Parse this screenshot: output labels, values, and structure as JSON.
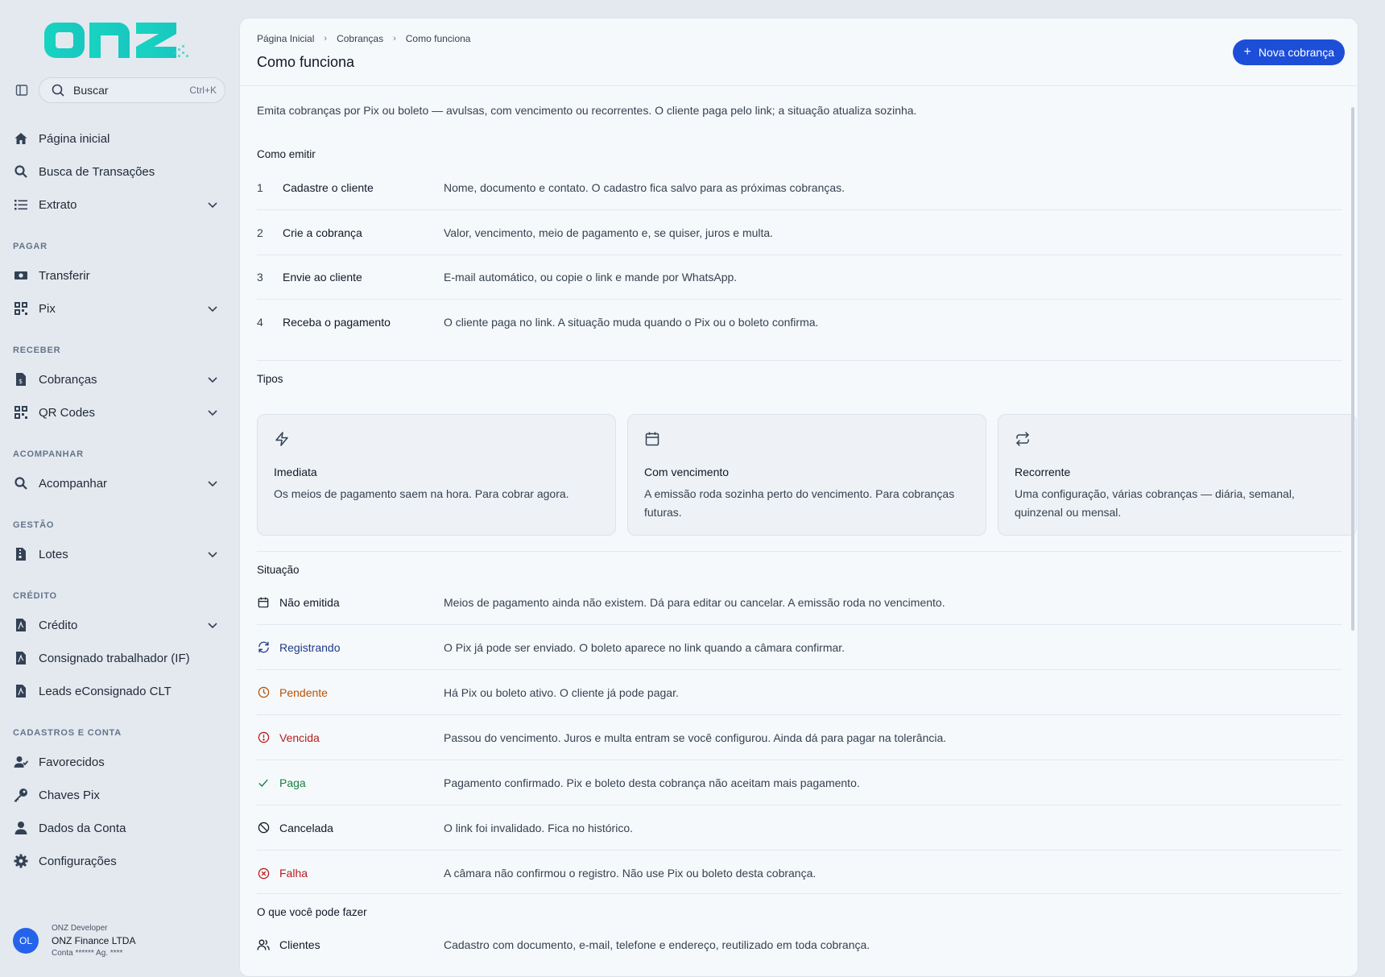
{
  "brand": {
    "logo_text": "onz"
  },
  "search": {
    "placeholder": "Buscar",
    "shortcut": "Ctrl+K"
  },
  "sidebar": {
    "items_top": [
      {
        "label": "Página inicial",
        "icon": "home-icon"
      },
      {
        "label": "Busca de Transações",
        "icon": "search-icon"
      },
      {
        "label": "Extrato",
        "icon": "list-icon",
        "expandable": true
      }
    ],
    "sections": [
      {
        "title": "PAGAR",
        "items": [
          {
            "label": "Transferir",
            "icon": "money-icon"
          },
          {
            "label": "Pix",
            "icon": "qr-icon",
            "expandable": true
          }
        ]
      },
      {
        "title": "RECEBER",
        "items": [
          {
            "label": "Cobranças",
            "icon": "invoice-icon",
            "expandable": true
          },
          {
            "label": "QR Codes",
            "icon": "qr-icon",
            "expandable": true
          }
        ]
      },
      {
        "title": "ACOMPANHAR",
        "items": [
          {
            "label": "Acompanhar",
            "icon": "search-icon",
            "expandable": true
          }
        ]
      },
      {
        "title": "GESTÃO",
        "items": [
          {
            "label": "Lotes",
            "icon": "zip-file-icon",
            "expandable": true
          }
        ]
      },
      {
        "title": "CRÉDITO",
        "items": [
          {
            "label": "Crédito",
            "icon": "pdf-file-icon",
            "expandable": true
          },
          {
            "label": "Consignado trabalhador (IF)",
            "icon": "pdf-file-icon"
          },
          {
            "label": "Leads eConsignado CLT",
            "icon": "pdf-file-icon"
          }
        ]
      },
      {
        "title": "CADASTROS E CONTA",
        "items": [
          {
            "label": "Favorecidos",
            "icon": "user-check-icon"
          },
          {
            "label": "Chaves Pix",
            "icon": "key-icon"
          },
          {
            "label": "Dados da Conta",
            "icon": "user-icon"
          },
          {
            "label": "Configurações",
            "icon": "gear-icon"
          }
        ]
      }
    ]
  },
  "user": {
    "initials": "OL",
    "role": "ONZ Developer",
    "company": "ONZ Finance LTDA",
    "account": "Conta ****** Ag. ****"
  },
  "header": {
    "breadcrumb": [
      "Página Inicial",
      "Cobranças",
      "Como funciona"
    ],
    "title": "Como funciona",
    "primary_button": "Nova cobrança"
  },
  "intro": "Emita cobranças por Pix ou boleto — avulsas, com vencimento ou recorrentes. O cliente paga pelo link; a situação atualiza sozinha.",
  "how_to": {
    "title": "Como emitir",
    "steps": [
      {
        "num": "1",
        "label": "Cadastre o cliente",
        "desc": "Nome, documento e contato. O cadastro fica salvo para as próximas cobranças."
      },
      {
        "num": "2",
        "label": "Crie a cobrança",
        "desc": "Valor, vencimento, meio de pagamento e, se quiser, juros e multa."
      },
      {
        "num": "3",
        "label": "Envie ao cliente",
        "desc": "E-mail automático, ou copie o link e mande por WhatsApp."
      },
      {
        "num": "4",
        "label": "Receba o pagamento",
        "desc": "O cliente paga no link. A situação muda quando o Pix ou o boleto confirma."
      }
    ]
  },
  "types": {
    "title": "Tipos",
    "cards": [
      {
        "icon": "lightning-icon",
        "title": "Imediata",
        "desc": "Os meios de pagamento saem na hora. Para cobrar agora."
      },
      {
        "icon": "calendar-icon",
        "title": "Com vencimento",
        "desc": "A emissão roda sozinha perto do vencimento. Para cobranças futuras."
      },
      {
        "icon": "repeat-icon",
        "title": "Recorrente",
        "desc": "Uma configuração, várias cobranças — diária, semanal, quinzenal ou mensal."
      }
    ]
  },
  "status": {
    "title": "Situação",
    "rows": [
      {
        "icon": "calendar-icon",
        "label": "Não emitida",
        "color": "#111827",
        "desc": "Meios de pagamento ainda não existem. Dá para editar ou cancelar. A emissão roda no vencimento."
      },
      {
        "icon": "refresh-icon",
        "label": "Registrando",
        "color": "#1e3a8a",
        "desc": "O Pix já pode ser enviado. O boleto aparece no link quando a câmara confirmar."
      },
      {
        "icon": "clock-icon",
        "label": "Pendente",
        "color": "#b45309",
        "desc": "Há Pix ou boleto ativo. O cliente já pode pagar."
      },
      {
        "icon": "alert-circle-icon",
        "label": "Vencida",
        "color": "#b91c1c",
        "desc": "Passou do vencimento. Juros e multa entram se você configurou. Ainda dá para pagar na tolerância."
      },
      {
        "icon": "check-icon",
        "label": "Paga",
        "color": "#15803d",
        "desc": "Pagamento confirmado. Pix e boleto desta cobrança não aceitam mais pagamento."
      },
      {
        "icon": "ban-icon",
        "label": "Cancelada",
        "color": "#111827",
        "desc": "O link foi invalidado. Fica no histórico."
      },
      {
        "icon": "x-circle-icon",
        "label": "Falha",
        "color": "#b91c1c",
        "desc": "A câmara não confirmou o registro. Não use Pix ou boleto desta cobrança."
      }
    ]
  },
  "actions": {
    "title": "O que você pode fazer",
    "rows": [
      {
        "icon": "users-icon",
        "label": "Clientes",
        "desc": "Cadastro com documento, e-mail, telefone e endereço, reutilizado em toda cobrança."
      }
    ]
  }
}
